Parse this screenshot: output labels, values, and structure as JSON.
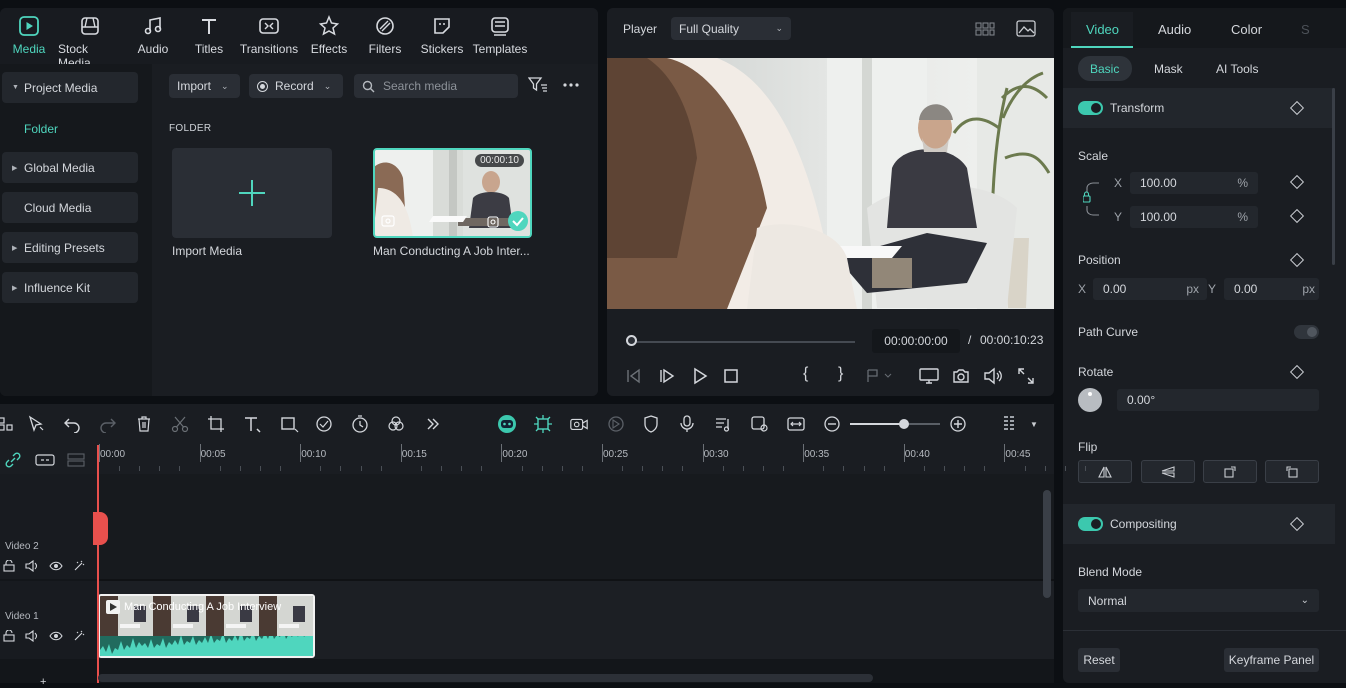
{
  "toolbar": {
    "items": [
      {
        "label": "Media",
        "icon": "media-icon",
        "active": true
      },
      {
        "label": "Stock Media",
        "icon": "stock-media-icon"
      },
      {
        "label": "Audio",
        "icon": "music-note-icon"
      },
      {
        "label": "Titles",
        "icon": "title-t-icon"
      },
      {
        "label": "Transitions",
        "icon": "transitions-icon"
      },
      {
        "label": "Effects",
        "icon": "effects-sparkle-icon"
      },
      {
        "label": "Filters",
        "icon": "filters-icon"
      },
      {
        "label": "Stickers",
        "icon": "stickers-icon"
      },
      {
        "label": "Templates",
        "icon": "templates-icon"
      }
    ]
  },
  "sidebar": {
    "items": [
      {
        "label": "Project Media",
        "expandable": true
      },
      {
        "label": "Global Media",
        "expandable": true
      },
      {
        "label": "Cloud Media",
        "expandable": false
      },
      {
        "label": "Editing Presets",
        "expandable": true
      },
      {
        "label": "Influence Kit",
        "expandable": true
      }
    ],
    "folder_label": "Folder"
  },
  "media": {
    "import_label": "Import",
    "record_label": "Record",
    "search_placeholder": "Search media",
    "folder_heading": "FOLDER",
    "import_card_label": "Import Media",
    "clip_label": "Man Conducting A Job Inter...",
    "clip_duration": "00:00:10"
  },
  "player": {
    "label": "Player",
    "quality": "Full Quality",
    "current_time": "00:00:00:00",
    "separator": "/",
    "total_time": "00:00:10:23",
    "progress": 0.0
  },
  "props": {
    "tabs": [
      "Video",
      "Audio",
      "Color",
      "S"
    ],
    "subtabs": [
      "Basic",
      "Mask",
      "AI Tools"
    ],
    "transform_label": "Transform",
    "scale_label": "Scale",
    "scale_x_axis": "X",
    "scale_y_axis": "Y",
    "scale_x": "100.00",
    "scale_y": "100.00",
    "percent": "%",
    "position_label": "Position",
    "pos_x_axis": "X",
    "pos_y_axis": "Y",
    "pos_x": "0.00",
    "pos_y": "0.00",
    "px": "px",
    "path_curve_label": "Path Curve",
    "rotate_label": "Rotate",
    "rotate_value": "0.00°",
    "flip_label": "Flip",
    "compositing_label": "Compositing",
    "blend_label": "Blend Mode",
    "blend_value": "Normal",
    "reset_label": "Reset",
    "keyframe_label": "Keyframe Panel"
  },
  "timeline": {
    "ruler": [
      "00:00",
      "00:05",
      "00:10",
      "00:15",
      "00:20",
      "00:25",
      "00:30",
      "00:35",
      "00:40",
      "00:45"
    ],
    "track_video2": "Video 2",
    "track_video1": "Video 1",
    "clip_title": "Man Conducting A Job Interview",
    "zoom_level": 0.6
  },
  "colors": {
    "accent": "#4fd6be",
    "playhead": "#e8504d",
    "panel": "#1a1d22"
  }
}
